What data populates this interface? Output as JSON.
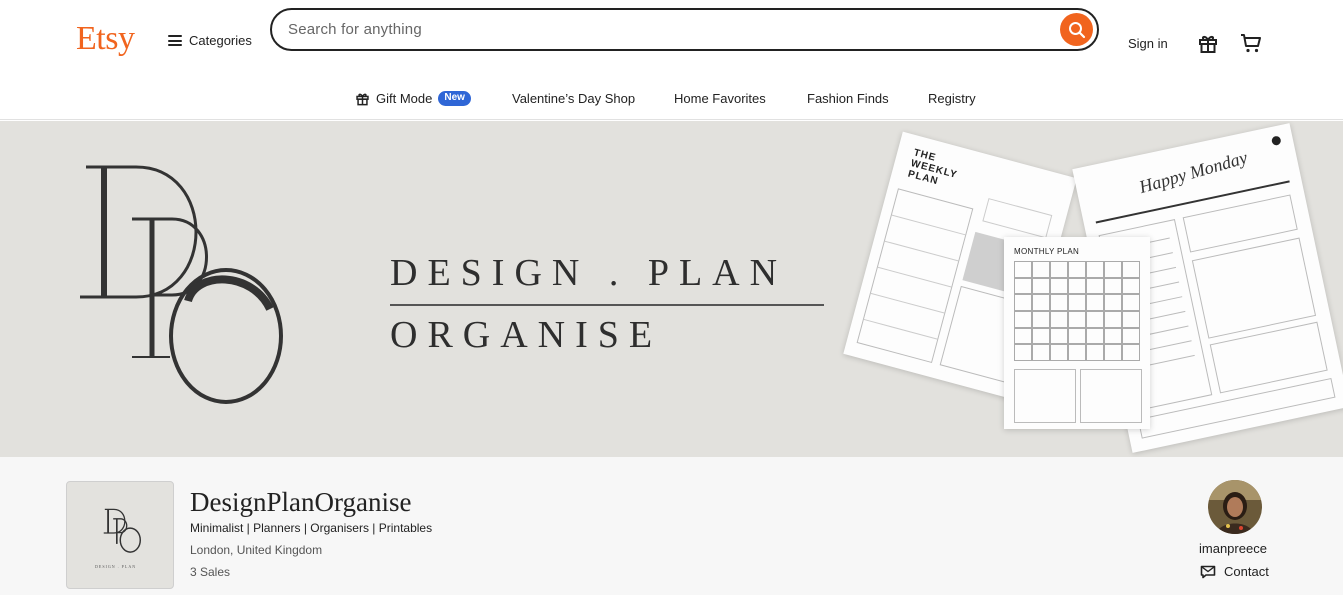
{
  "header": {
    "logo": "Etsy",
    "categories_label": "Categories",
    "search_placeholder": "Search for anything",
    "signin_label": "Sign in",
    "accent_color": "#F1641E"
  },
  "nav": {
    "items": [
      {
        "label": "Gift Mode",
        "badge": "New",
        "icon": "gift-icon"
      },
      {
        "label": "Valentine’s Day Shop"
      },
      {
        "label": "Home Favorites"
      },
      {
        "label": "Fashion Finds"
      },
      {
        "label": "Registry"
      }
    ],
    "badge_color": "#2F66D6"
  },
  "banner": {
    "line1": "DESIGN . PLAN",
    "line2": "ORGANISE",
    "background": "#E2E1DD",
    "weekly_title": "THE WEEKLY PLAN",
    "monthly_title": "MONTHLY PLAN",
    "daily_script": "Happy Monday"
  },
  "shop": {
    "name": "DesignPlanOrganise",
    "tagline": "Minimalist | Planners | Organisers | Printables",
    "location": "London, United Kingdom",
    "sales": "3 Sales",
    "owner": "imanpreece",
    "contact_label": "Contact"
  }
}
